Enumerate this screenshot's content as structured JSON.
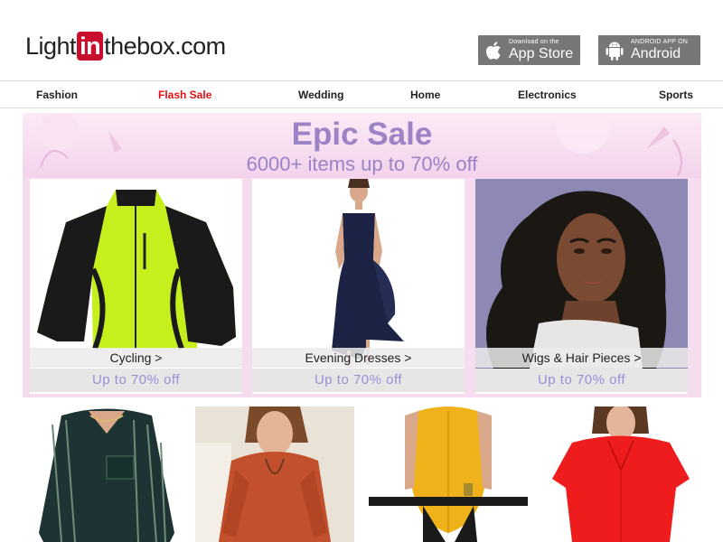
{
  "logo": {
    "pre": "Light",
    "mid": "in",
    "post": "thebox.com"
  },
  "apps": {
    "ios": {
      "small": "Download on the",
      "big": "App Store",
      "icon": "apple-icon"
    },
    "android": {
      "small": "ANDROID APP ON",
      "big": "Android",
      "icon": "android-icon"
    }
  },
  "nav": [
    "Fashion",
    "Flash Sale",
    "Wedding",
    "Home",
    "Electronics",
    "Sports"
  ],
  "banner": {
    "headline": "Epic Sale",
    "subline": "6000+ items up to 70% off"
  },
  "cards": [
    {
      "label": "Cycling >",
      "offer": "Up to 70% off"
    },
    {
      "label": "Evening Dresses >",
      "offer": "Up to 70% off"
    },
    {
      "label": "Wigs & Hair Pieces >",
      "offer": "Up to 70% off"
    }
  ],
  "colors": {
    "accent_red": "#c8102e",
    "flash_red": "#e01010",
    "sale_purple": "#9b83c6",
    "banner_pink": "#f5dcef"
  }
}
